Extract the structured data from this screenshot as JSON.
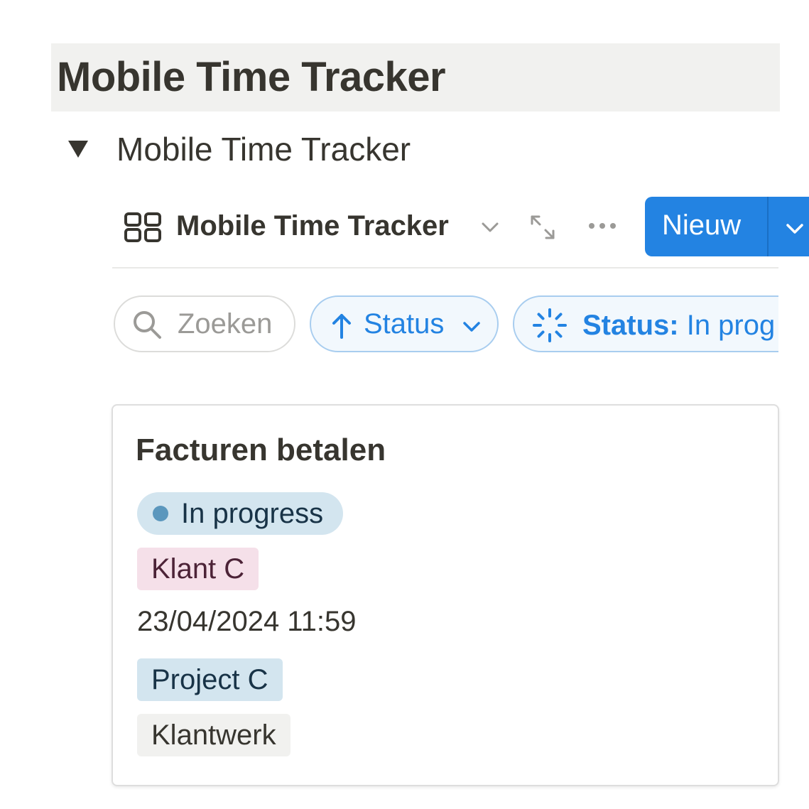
{
  "page": {
    "title": "Mobile Time Tracker"
  },
  "toggle": {
    "label": "Mobile Time Tracker",
    "icon": "triangle-down-icon",
    "expanded": true
  },
  "view_bar": {
    "view_icon": "gallery-view-icon",
    "view_name": "Mobile Time Tracker",
    "chevron_icon": "chevron-down-icon",
    "expand_icon": "expand-icon",
    "more_icon": "more-horizontal-icon",
    "new_button": {
      "label": "Nieuw",
      "color": "#2383e2",
      "dropdown_icon": "chevron-down-icon"
    }
  },
  "filters": {
    "search": {
      "icon": "search-icon",
      "placeholder": "Zoeken"
    },
    "sort": {
      "icon": "arrow-up-icon",
      "label": "Status",
      "chevron_icon": "chevron-down-icon"
    },
    "filter": {
      "icon": "in-progress-spinner-icon",
      "key": "Status:",
      "value": "In prog"
    },
    "accent_color": "#2383e2"
  },
  "card": {
    "title": "Facturen betalen",
    "status": {
      "label": "In progress",
      "background": "#d3e5ef",
      "dot_color": "#5b97bd"
    },
    "client_tag": {
      "label": "Klant C",
      "background": "#f5e0e9"
    },
    "datetime": "23/04/2024 11:59",
    "project_tag": {
      "label": "Project C",
      "background": "#d3e5ef"
    },
    "type_tag": {
      "label": "Klantwerk",
      "background": "#f1f1ef"
    }
  }
}
